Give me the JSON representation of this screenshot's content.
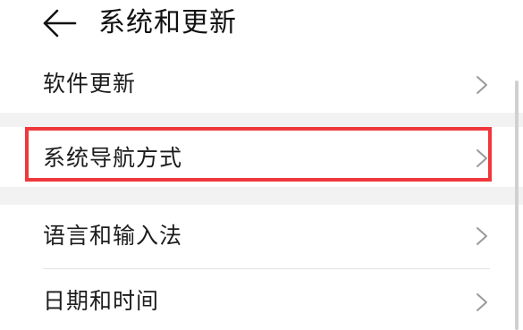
{
  "header": {
    "title": "系统和更新",
    "back_icon": "arrow-left-icon"
  },
  "settings": {
    "items": [
      {
        "label": "软件更新"
      },
      {
        "label": "系统导航方式"
      },
      {
        "label": "语言和输入法"
      },
      {
        "label": "日期和时间"
      }
    ]
  },
  "colors": {
    "highlight": "#f0373c",
    "section_gap": "#f2f2f2"
  }
}
